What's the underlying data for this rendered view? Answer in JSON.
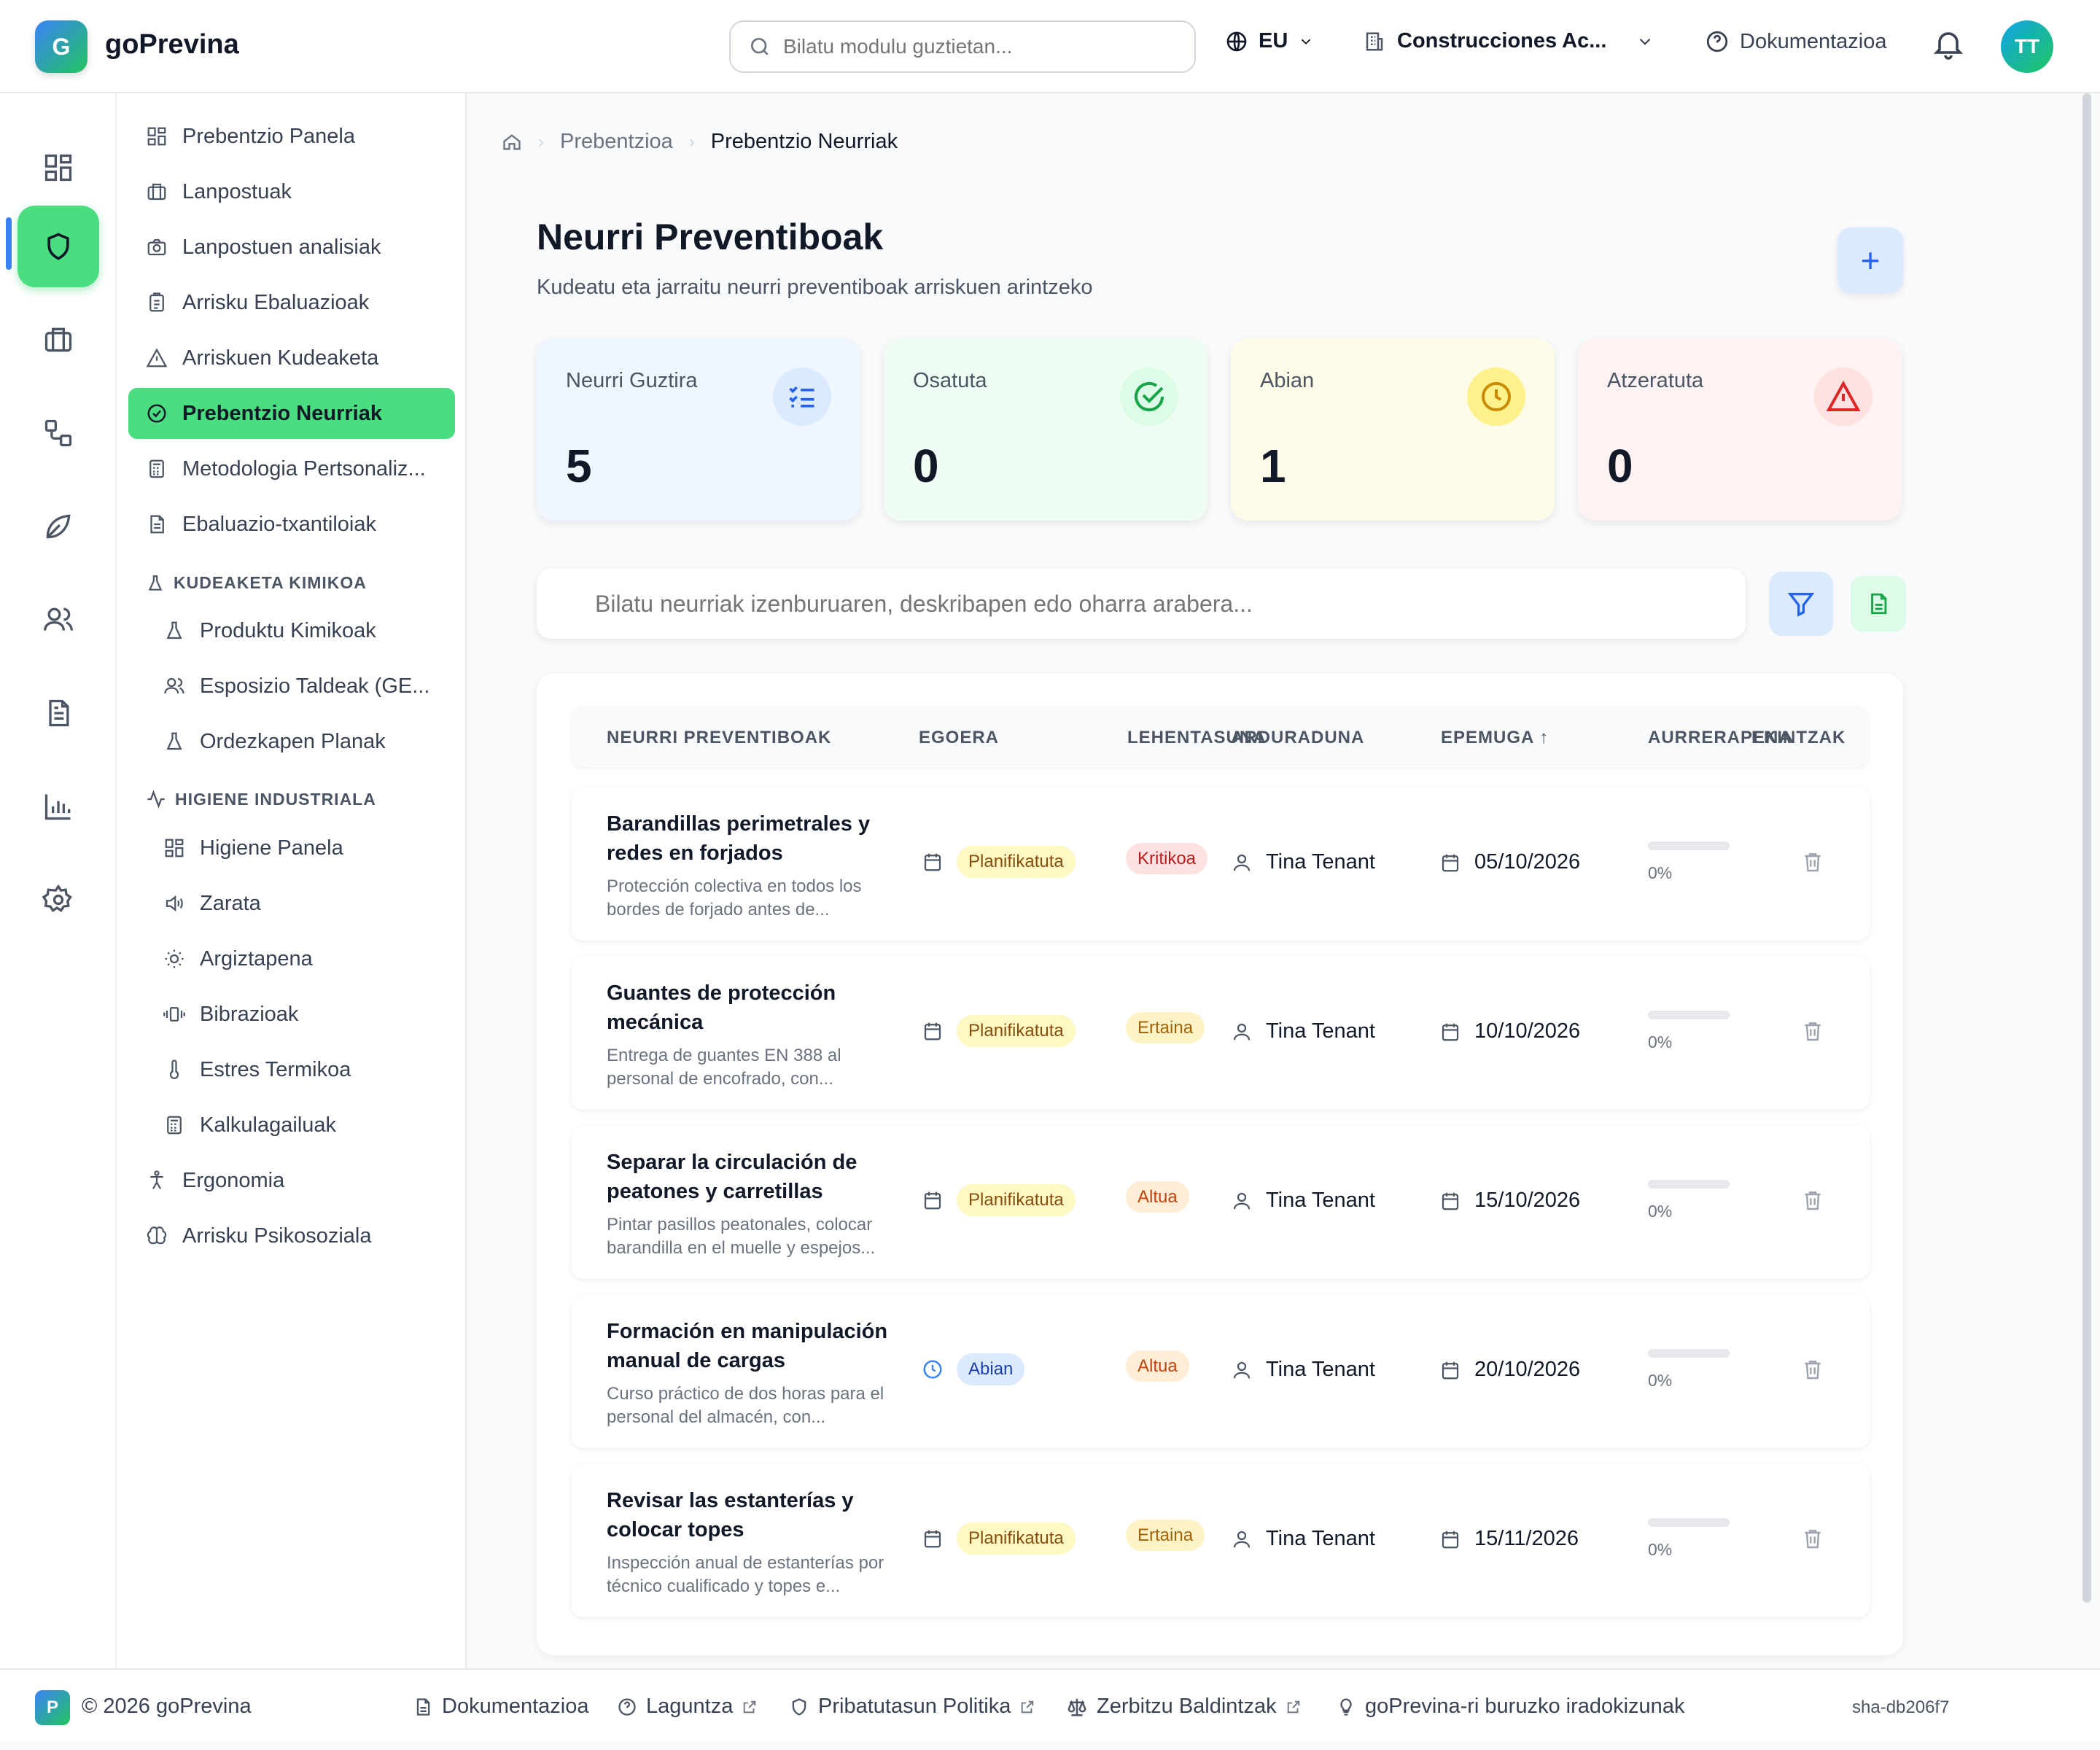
{
  "app": {
    "logo_letter": "G",
    "name": "goPrevina"
  },
  "topbar": {
    "search_placeholder": "Bilatu modulu guztietan...",
    "language": "EU",
    "company": "Construcciones Ac...",
    "docs_label": "Dokumentazioa",
    "avatar_initials": "TT"
  },
  "rail": {
    "items": [
      "dashboard-icon",
      "shield-icon",
      "briefcase-icon",
      "workflow-icon",
      "leaf-icon",
      "users-icon",
      "document-icon",
      "chart-icon",
      "gear-icon"
    ],
    "active": "shield-icon"
  },
  "sidebar": {
    "items": [
      {
        "label": "Prebentzio Panela",
        "icon": "dashboard-icon"
      },
      {
        "label": "Lanpostuak",
        "icon": "briefcase-icon"
      },
      {
        "label": "Lanpostuen analisiak",
        "icon": "camera-icon"
      },
      {
        "label": "Arrisku Ebaluazioak",
        "icon": "clipboard-icon"
      },
      {
        "label": "Arriskuen Kudeaketa",
        "icon": "warning-icon"
      },
      {
        "label": "Prebentzio Neurriak",
        "icon": "check-circle-icon",
        "active": true
      },
      {
        "label": "Metodologia Pertsonaliz...",
        "icon": "calculator-icon"
      },
      {
        "label": "Ebaluazio-txantiloiak",
        "icon": "file-icon"
      }
    ],
    "section_chemical": "KUDEAKETA KIMIKOA",
    "chemical_items": [
      {
        "label": "Produktu Kimikoak",
        "icon": "flask-icon"
      },
      {
        "label": "Esposizio Taldeak (GE...",
        "icon": "users-icon"
      },
      {
        "label": "Ordezkapen Planak",
        "icon": "flask-icon"
      }
    ],
    "section_hygiene": "HIGIENE INDUSTRIALA",
    "hygiene_items": [
      {
        "label": "Higiene Panela",
        "icon": "dashboard-icon"
      },
      {
        "label": "Zarata",
        "icon": "speaker-icon"
      },
      {
        "label": "Argiztapena",
        "icon": "sun-icon"
      },
      {
        "label": "Bibrazioak",
        "icon": "vibration-icon"
      },
      {
        "label": "Estres Termikoa",
        "icon": "thermometer-icon"
      },
      {
        "label": "Kalkulagailuak",
        "icon": "calculator-icon"
      }
    ],
    "bottom_items": [
      {
        "label": "Ergonomia",
        "icon": "person-icon"
      },
      {
        "label": "Arrisku Psikosoziala",
        "icon": "brain-icon"
      }
    ]
  },
  "breadcrumb": {
    "level1": "Prebentzioa",
    "current": "Prebentzio Neurriak"
  },
  "page": {
    "title": "Neurri Preventiboak",
    "subtitle": "Kudeatu eta jarraitu neurri preventiboak arriskuen arintzeko",
    "add_label": "+"
  },
  "stats": [
    {
      "label": "Neurri Guztira",
      "value": "5",
      "bg": "#eff6ff",
      "color": "#2563eb",
      "icon_bg": "#dbeafe"
    },
    {
      "label": "Osatuta",
      "value": "0",
      "bg": "#f0fdf4",
      "color": "#16a34a",
      "icon_bg": "#dcfce7"
    },
    {
      "label": "Abian",
      "value": "1",
      "bg": "#fefce8",
      "color": "#ca8a04",
      "icon_bg": "#fef08a"
    },
    {
      "label": "Atzeratuta",
      "value": "0",
      "bg": "#fef2f2",
      "color": "#dc2626",
      "icon_bg": "#fee2e2"
    }
  ],
  "search": {
    "placeholder": "Bilatu neurriak izenburuaren, deskribapen edo oharra arabera..."
  },
  "table": {
    "headers": {
      "measures": "NEURRI PREVENTIBOAK",
      "status": "EGOERA",
      "priority": "LEHENTASUNA",
      "responsible": "ARDURADUNA",
      "deadline": "EPEMUGA ↑",
      "progress": "AURRERAPENA",
      "actions": "EKINTZAK"
    },
    "rows": [
      {
        "title": "Barandillas perimetrales y redes en forjados",
        "desc": "Protección colectiva en todos los bordes de forjado antes de...",
        "status": "Planifikatuta",
        "status_kind": "plan",
        "priority": "Kritikoa",
        "priority_kind": "krit",
        "responsible": "Tina Tenant",
        "deadline": "05/10/2026",
        "progress": "0%",
        "progress_value": 0
      },
      {
        "title": "Guantes de protección mecánica",
        "desc": "Entrega de guantes EN 388 al personal de encofrado, con...",
        "status": "Planifikatuta",
        "status_kind": "plan",
        "priority": "Ertaina",
        "priority_kind": "ert",
        "responsible": "Tina Tenant",
        "deadline": "10/10/2026",
        "progress": "0%",
        "progress_value": 0
      },
      {
        "title": "Separar la circulación de peatones y carretillas",
        "desc": "Pintar pasillos peatonales, colocar barandilla en el muelle y espejos...",
        "status": "Planifikatuta",
        "status_kind": "plan",
        "priority": "Altua",
        "priority_kind": "alt",
        "responsible": "Tina Tenant",
        "deadline": "15/10/2026",
        "progress": "0%",
        "progress_value": 0
      },
      {
        "title": "Formación en manipulación manual de cargas",
        "desc": "Curso práctico de dos horas para el personal del almacén, con...",
        "status": "Abian",
        "status_kind": "abian",
        "priority": "Altua",
        "priority_kind": "alt",
        "responsible": "Tina Tenant",
        "deadline": "20/10/2026",
        "progress": "0%",
        "progress_value": 0
      },
      {
        "title": "Revisar las estanterías y colocar topes",
        "desc": "Inspección anual de estanterías por técnico cualificado y topes e...",
        "status": "Planifikatuta",
        "status_kind": "plan",
        "priority": "Ertaina",
        "priority_kind": "ert",
        "responsible": "Tina Tenant",
        "deadline": "15/11/2026",
        "progress": "0%",
        "progress_value": 0
      }
    ]
  },
  "footer": {
    "logo_letter": "P",
    "copyright": "© 2026 goPrevina",
    "links": [
      "Dokumentazioa",
      "Laguntza",
      "Pribatutasun Politika",
      "Zerbitzu Baldintzak",
      "goPrevina-ri buruzko iradokizunak"
    ],
    "sha": "sha-db206f7"
  }
}
